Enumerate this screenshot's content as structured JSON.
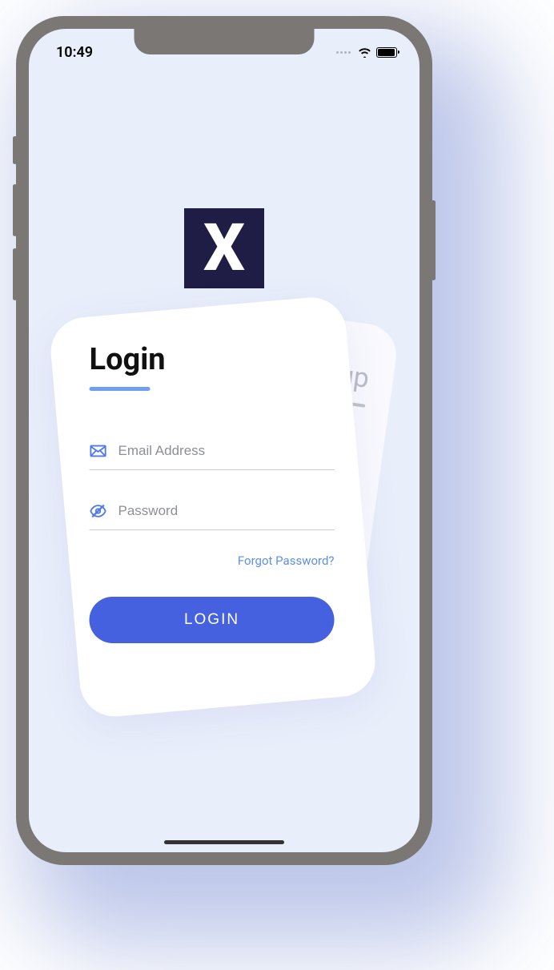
{
  "status_bar": {
    "time": "10:49"
  },
  "logo": {
    "letter": "X"
  },
  "tabs": {
    "login": {
      "label": "Login"
    },
    "signup": {
      "label": "Sign up"
    }
  },
  "form": {
    "email": {
      "placeholder": "Email Address",
      "value": ""
    },
    "password": {
      "placeholder": "Password",
      "value": ""
    },
    "forgot_label": "Forgot Password?",
    "submit_label": "LOGIN"
  },
  "colors": {
    "accent": "#4561e0",
    "accent_light": "#6f9ff2",
    "bg_screen": "#e9eefb",
    "logo_bg": "#1f1d45"
  }
}
